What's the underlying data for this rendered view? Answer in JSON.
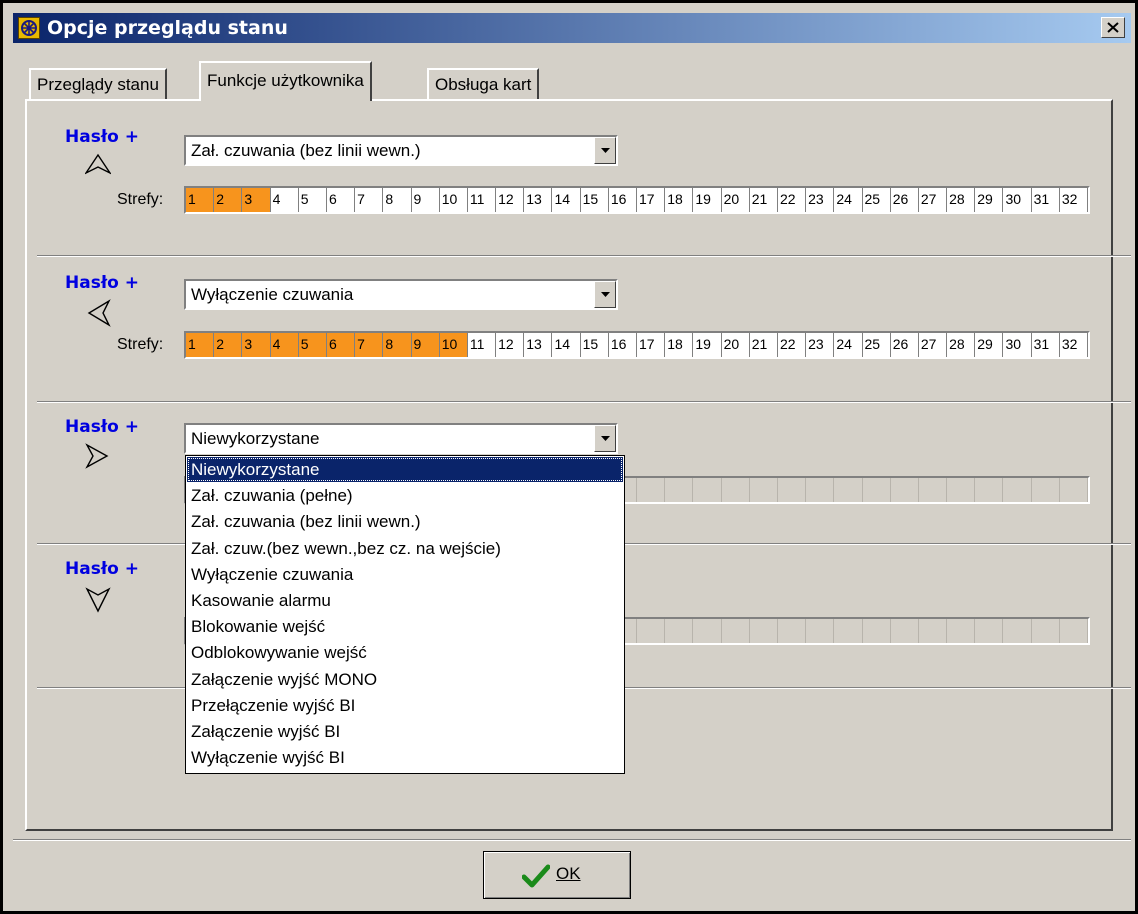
{
  "window": {
    "title": "Opcje przeglądu stanu"
  },
  "tabs": [
    "Przeglądy stanu",
    "Funkcje użytkownika",
    "Obsługa kart"
  ],
  "active_tab": 1,
  "groups": [
    {
      "label": "Hasło +",
      "arrow": "arrow-up-icon",
      "function": "Zał. czuwania (bez linii wewn.)",
      "strefy_label": "Strefy:",
      "active_zones": 3
    },
    {
      "label": "Hasło +",
      "arrow": "arrow-left-icon",
      "function": "Wyłączenie czuwania",
      "strefy_label": "Strefy:",
      "active_zones": 10
    },
    {
      "label": "Hasło +",
      "arrow": "arrow-right-icon",
      "function": "Niewykorzystane"
    },
    {
      "label": "Hasło +",
      "arrow": "arrow-down-icon"
    }
  ],
  "zones": [
    "1",
    "2",
    "3",
    "4",
    "5",
    "6",
    "7",
    "8",
    "9",
    "10",
    "11",
    "12",
    "13",
    "14",
    "15",
    "16",
    "17",
    "18",
    "19",
    "20",
    "21",
    "22",
    "23",
    "24",
    "25",
    "26",
    "27",
    "28",
    "29",
    "30",
    "31",
    "32"
  ],
  "dropdown": {
    "selected": "Niewykorzystane",
    "options": [
      "Niewykorzystane",
      "Zał. czuwania (pełne)",
      "Zał. czuwania (bez linii wewn.)",
      "Zał. czuw.(bez wewn.,bez cz. na wejście)",
      "Wyłączenie czuwania",
      "Kasowanie alarmu",
      "Blokowanie wejść",
      "Odblokowywanie wejść",
      "Załączenie wyjść MONO",
      "Przełączenie wyjść BI",
      "Załączenie wyjść BI",
      "Wyłączenie wyjść BI"
    ]
  },
  "ok_button": {
    "label": "OK"
  },
  "colors": {
    "title_start": "#0a246a",
    "title_end": "#a6caf0",
    "zone_on": "#f7941d",
    "haslo_text": "#0000e0",
    "face": "#d4d0c8"
  }
}
